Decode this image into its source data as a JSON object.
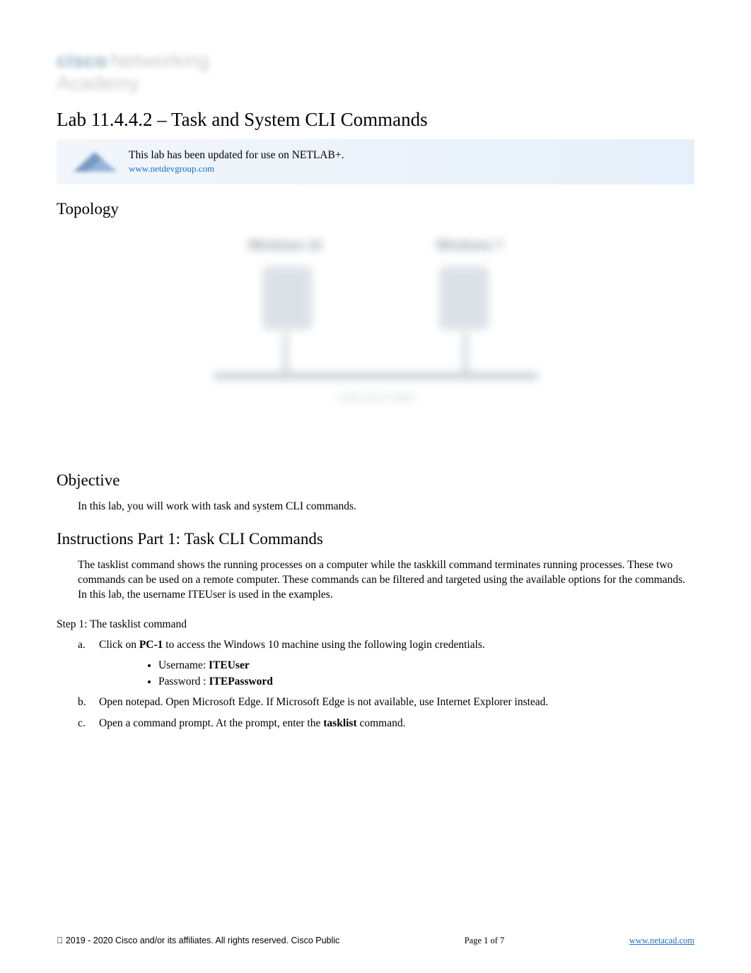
{
  "logo": {
    "brand": "cisco",
    "line1": "Networking",
    "line2": "Academy"
  },
  "lab": {
    "number": "11.4.4.2",
    "title_prefix": "Lab ",
    "title_sep": " – ",
    "title": "Task and System CLI Commands"
  },
  "netlab_banner": {
    "text": "This lab has been updated for use on NETLAB+.",
    "link": "www.netdevgroup.com"
  },
  "sections": {
    "topology": "Topology",
    "objective": "Objective",
    "instructions": "Instructions Part 1: Task CLI Commands"
  },
  "topology_diagram": {
    "left_label": "Windows 10",
    "right_label": "Windows 7",
    "lan_label": "LAN\n10.0.1.0/24"
  },
  "objective_body": "In this lab, you will work with task and system CLI commands.",
  "instructions_body": "The tasklist command shows the running processes on a computer while the taskkill command terminates running processes. These two commands can be used on a remote computer. These commands can be filtered and targeted using the available options for the commands. In this lab, the username ITEUser is used in the examples.",
  "step1": {
    "heading": "Step 1: The tasklist command",
    "a": {
      "prefix": "Click on ",
      "bold": "PC-1",
      "suffix": " to access the Windows 10 machine using the following login credentials."
    },
    "credentials": {
      "username_label": "Username:   ",
      "username_value": "ITEUser",
      "password_label": "Password   : ",
      "password_value": "ITEPassword"
    },
    "b": "Open notepad. Open Microsoft Edge. If Microsoft Edge is not available, use Internet Explorer instead.",
    "c": {
      "prefix": "Open a command prompt. At the prompt, enter the ",
      "bold": "tasklist",
      "suffix": " command."
    }
  },
  "footer": {
    "copyright": " 2019 - 2020 Cisco and/or its affiliates. All rights reserved. Cisco Public",
    "page_prefix": "Page ",
    "page_current": "1",
    "page_of": " of ",
    "page_total": "7",
    "link": "www.netacad.com"
  }
}
